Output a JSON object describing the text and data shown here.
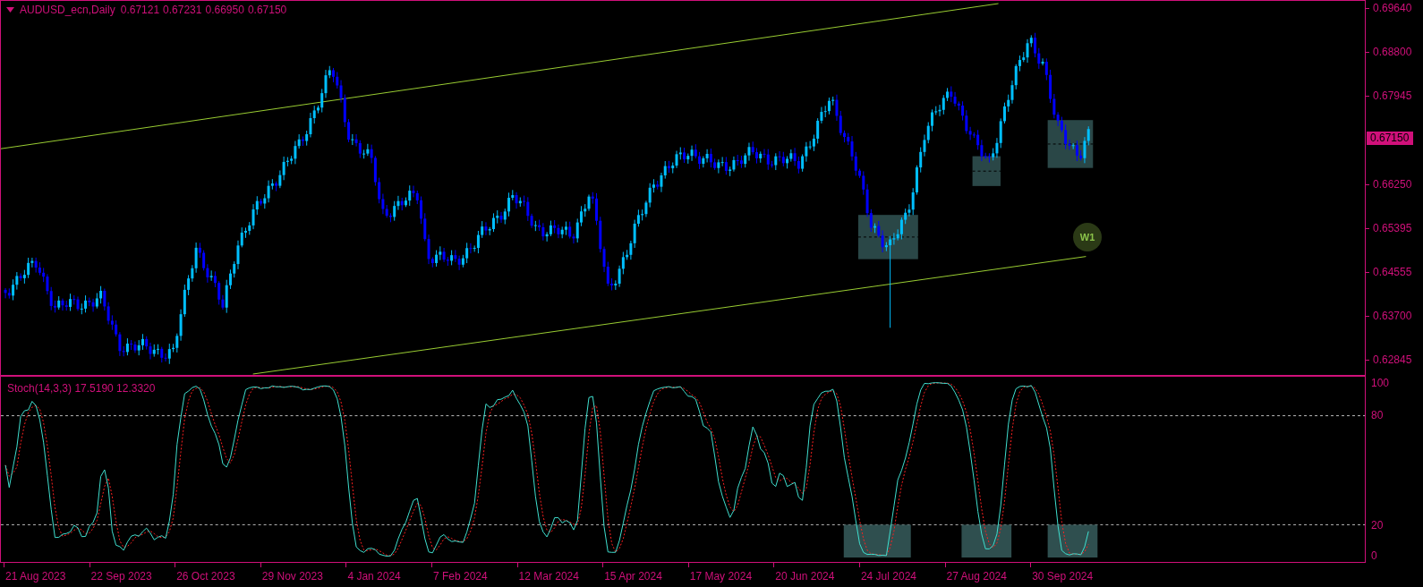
{
  "header": {
    "symbol": "AUDUSD_ecn,Daily",
    "open": "0.67121",
    "high": "0.67231",
    "low": "0.66950",
    "close": "0.67150"
  },
  "price_axis": {
    "labels": [
      "0.69640",
      "0.68800",
      "0.67945",
      "0.66250",
      "0.65395",
      "0.64555",
      "0.63700",
      "0.62845"
    ],
    "current_price": "0.67150"
  },
  "badge": {
    "label": "W1"
  },
  "indicator": {
    "title": "Stoch(14,3,3) 17.5190 12.3320",
    "levels": [
      "100",
      "80",
      "20",
      "0"
    ]
  },
  "time_axis": {
    "labels": [
      "21 Aug 2023",
      "22 Sep 2023",
      "26 Oct 2023",
      "29 Nov 2023",
      "4 Jan 2024",
      "7 Feb 2024",
      "12 Mar 2024",
      "15 Apr 2024",
      "17 May 2024",
      "20 Jun 2024",
      "24 Jul 2024",
      "27 Aug 2024",
      "30 Sep 2024"
    ]
  }
}
